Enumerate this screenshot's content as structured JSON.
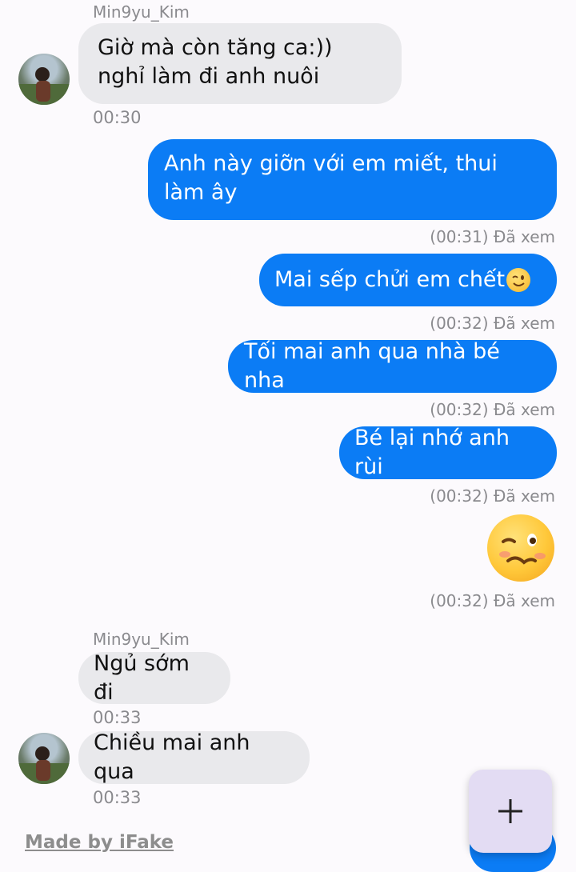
{
  "messages": {
    "m1": {
      "sender": "Min9yu_Kim",
      "text": "Giờ mà còn tăng ca:)) nghỉ làm đi anh nuôi",
      "time": "00:30"
    },
    "m2": {
      "text": "Anh này giỡn với em miết, thui làm ây",
      "status": "(00:31) Đã xem"
    },
    "m3": {
      "text": "Mai sếp chửi em chết",
      "emoji": "winking-face",
      "status": "(00:32) Đã xem"
    },
    "m4": {
      "text": "Tối mai anh qua nhà bé nha",
      "status": "(00:32) Đã xem"
    },
    "m5": {
      "text": "Bé lại nhớ anh rùi",
      "status": "(00:32) Đã xem"
    },
    "m6": {
      "emoji": "woozy-face",
      "status": "(00:32) Đã xem"
    },
    "m7": {
      "sender": "Min9yu_Kim",
      "text": "Ngủ sớm đi",
      "time": "00:33"
    },
    "m8": {
      "text": "Chiều mai anh qua",
      "time": "00:33"
    }
  },
  "footer": {
    "made_by": "Made by iFake"
  },
  "fab": {
    "icon": "plus-icon"
  },
  "colors": {
    "outgoing": "#0b7cf5",
    "incoming": "#e9e9ec",
    "background": "#fcfafd",
    "fab": "#e3dcf3"
  }
}
